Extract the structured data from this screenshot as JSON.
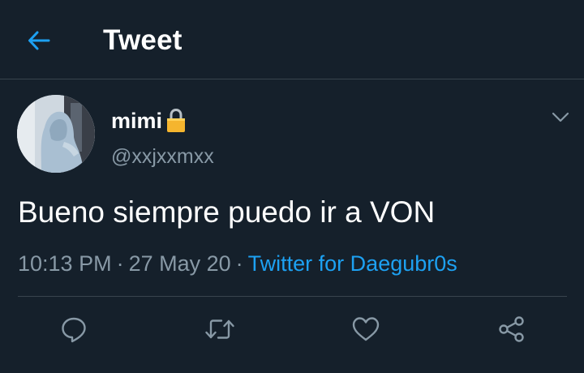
{
  "header": {
    "title": "Tweet",
    "back_icon": "arrow-left-icon",
    "accent_color": "#1da1f2"
  },
  "tweet": {
    "author": {
      "display_name": "mimi",
      "protected_icon": "lock-icon",
      "handle": "@xxjxxmxx"
    },
    "menu_icon": "chevron-down-icon",
    "text": "Bueno siempre puedo ir a VON",
    "time": "10:13 PM",
    "separator": "·",
    "date": "27 May 20",
    "source": "Twitter for Daegubr0s"
  },
  "actions": [
    {
      "name": "reply",
      "icon": "reply-icon"
    },
    {
      "name": "retweet",
      "icon": "retweet-icon"
    },
    {
      "name": "like",
      "icon": "heart-icon"
    },
    {
      "name": "share",
      "icon": "share-icon"
    }
  ],
  "colors": {
    "background": "#15202b",
    "secondary_text": "#8899a6",
    "border": "#38444d",
    "link": "#1da1f2"
  }
}
